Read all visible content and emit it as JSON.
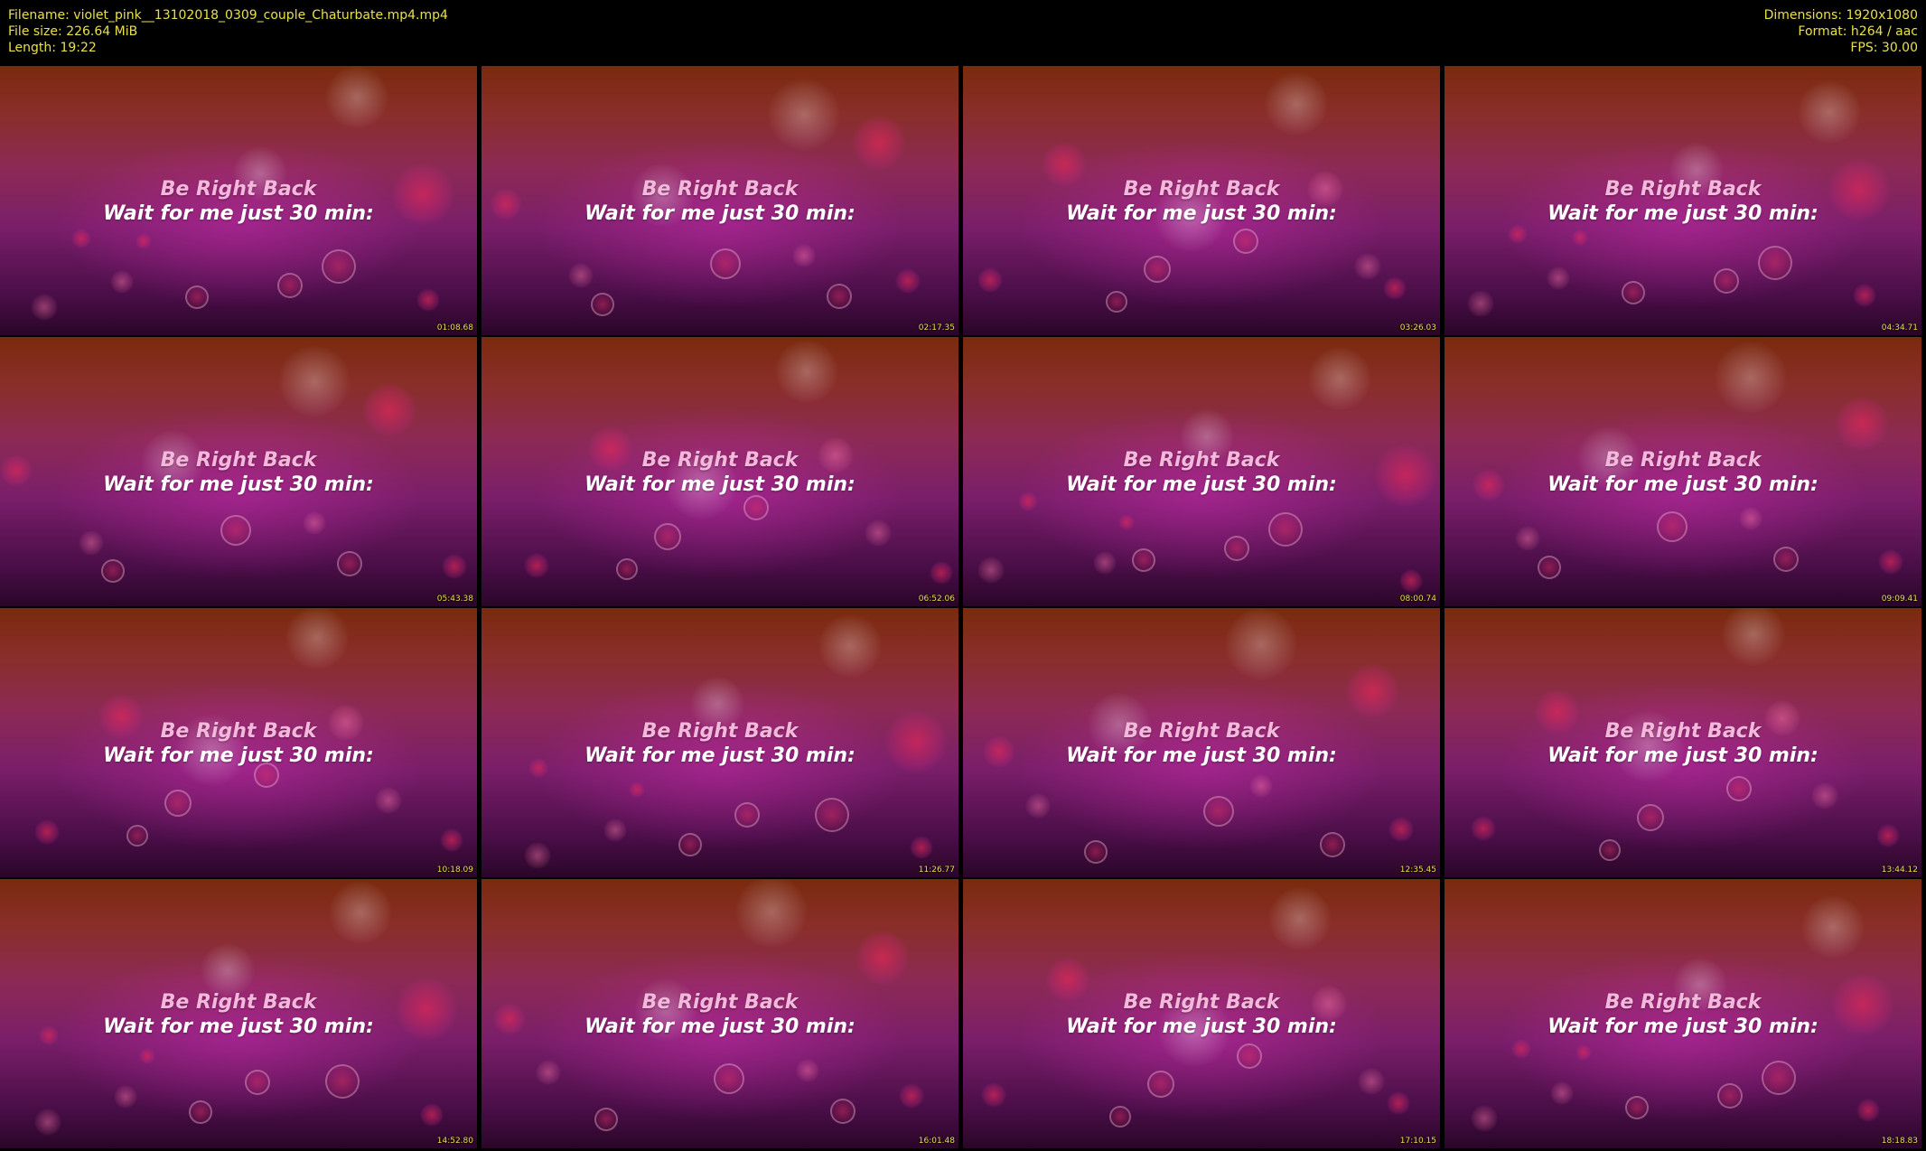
{
  "header": {
    "filename": "Filename: violet_pink__13102018_0309_couple_Chaturbate.mp4.mp4",
    "file_size": "File size: 226.64 MiB",
    "length": "Length: 19:22",
    "dimensions": "Dimensions: 1920x1080",
    "format": "Format: h264 / aac",
    "fps": "FPS: 30.00"
  },
  "colors": {
    "meta_text": "#e8e04a",
    "timestamp_text": "#e8e04a",
    "background": "#000000",
    "caption_line1": "#f3b8dc",
    "caption_line2": "#ffffff"
  },
  "thumbnails": [
    {
      "line1": "Be Right Back",
      "line2": "Wait for me just 30 min:",
      "timestamp": "01:08.68"
    },
    {
      "line1": "Be Right Back",
      "line2": "Wait for me just 30 min:",
      "timestamp": "02:17.35"
    },
    {
      "line1": "Be Right Back",
      "line2": "Wait for me just 30 min:",
      "timestamp": "03:26.03"
    },
    {
      "line1": "Be Right Back",
      "line2": "Wait for me just 30 min:",
      "timestamp": "04:34.71"
    },
    {
      "line1": "Be Right Back",
      "line2": "Wait for me just 30 min:",
      "timestamp": "05:43.38"
    },
    {
      "line1": "Be Right Back",
      "line2": "Wait for me just 30 min:",
      "timestamp": "06:52.06"
    },
    {
      "line1": "Be Right Back",
      "line2": "Wait for me just 30 min:",
      "timestamp": "08:00.74"
    },
    {
      "line1": "Be Right Back",
      "line2": "Wait for me just 30 min:",
      "timestamp": "09:09.41"
    },
    {
      "line1": "Be Right Back",
      "line2": "Wait for me just 30 min:",
      "timestamp": "10:18.09"
    },
    {
      "line1": "Be Right Back",
      "line2": "Wait for me just 30 min:",
      "timestamp": "11:26.77"
    },
    {
      "line1": "Be Right Back",
      "line2": "Wait for me just 30 min:",
      "timestamp": "12:35.45"
    },
    {
      "line1": "Be Right Back",
      "line2": "Wait for me just 30 min:",
      "timestamp": "13:44.12"
    },
    {
      "line1": "Be Right Back",
      "line2": "Wait for me just 30 min:",
      "timestamp": "14:52.80"
    },
    {
      "line1": "Be Right Back",
      "line2": "Wait for me just 30 min:",
      "timestamp": "16:01.48"
    },
    {
      "line1": "Be Right Back",
      "line2": "Wait for me just 30 min:",
      "timestamp": "17:10.15"
    },
    {
      "line1": "Be Right Back",
      "line2": "Wait for me just 30 min:",
      "timestamp": "18:18.83"
    }
  ]
}
